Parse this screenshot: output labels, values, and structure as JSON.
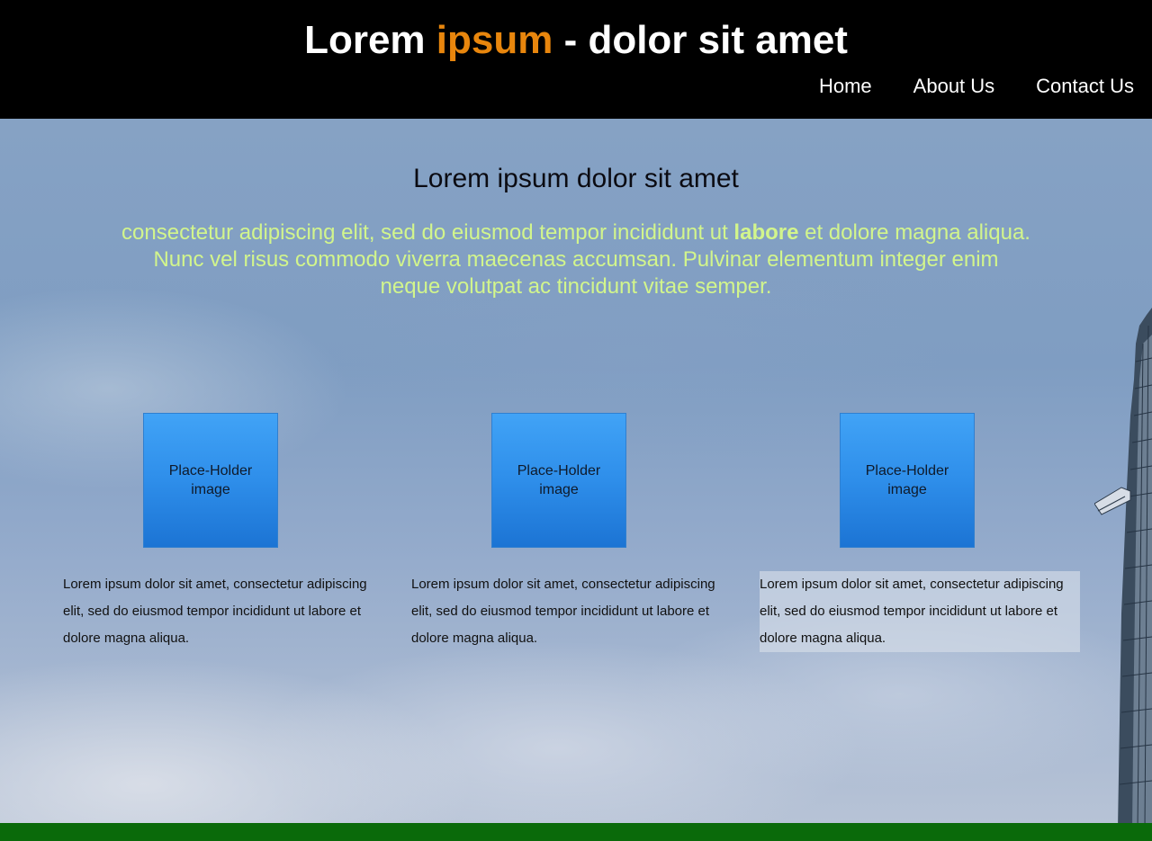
{
  "header": {
    "title_part1": "Lorem ",
    "title_accent": "ipsum",
    "title_part2": " - dolor sit amet",
    "title_accent_color": "#e8860d",
    "nav": [
      {
        "label": "Home"
      },
      {
        "label": "About Us"
      },
      {
        "label": "Contact Us"
      }
    ]
  },
  "hero": {
    "heading": "Lorem ipsum dolor sit amet",
    "text_before": "consectetur adipiscing elit, sed do eiusmod tempor incididunt ut ",
    "text_bold": "labore",
    "text_after": " et dolore magna aliqua. Nunc vel risus commodo viverra maecenas accumsan. Pulvinar elementum integer enim neque volutpat ac tincidunt vitae semper.",
    "text_color": "#d2f58c"
  },
  "cards": [
    {
      "image_label": "Place-Holder image",
      "text": "Lorem ipsum dolor sit amet, consectetur adipiscing elit, sed do eiusmod tempor incididunt ut labore et dolore magna aliqua."
    },
    {
      "image_label": "Place-Holder image",
      "text": "Lorem ipsum dolor sit amet, consectetur adipiscing elit, sed do eiusmod tempor incididunt ut labore et dolore magna aliqua."
    },
    {
      "image_label": "Place-Holder image",
      "text": "Lorem ipsum dolor sit amet, consectetur adipiscing elit, sed do eiusmod tempor incididunt ut labore et dolore magna aliqua."
    }
  ],
  "colors": {
    "header_bg": "#000000",
    "footer_bg": "#0a6a0a",
    "placeholder_blue": "#2e8eea"
  }
}
